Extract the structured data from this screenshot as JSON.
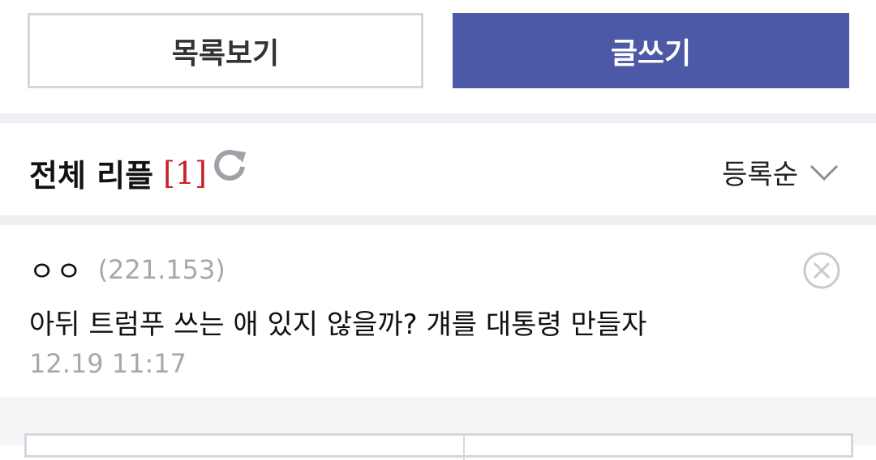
{
  "top_buttons": {
    "list_label": "목록보기",
    "write_label": "글쓰기"
  },
  "comments_header": {
    "title": "전체 리플",
    "count": "[1]",
    "sort_label": "등록순"
  },
  "comments": [
    {
      "author": "ㅇㅇ",
      "ip": "(221.153)",
      "text": "아뒤 트럼푸 쓰는 애 있지 않을까? 걔를 대통령 만들자",
      "time": "12.19 11:17"
    }
  ],
  "colors": {
    "accent": "#4c59a6",
    "count_red": "#c8202a",
    "muted_text": "#a7a8ad",
    "separator": "#eeeff3"
  },
  "icons": {
    "refresh": "refresh-icon",
    "sort_chevron": "chevron-down-icon",
    "delete": "close-circle-icon"
  }
}
